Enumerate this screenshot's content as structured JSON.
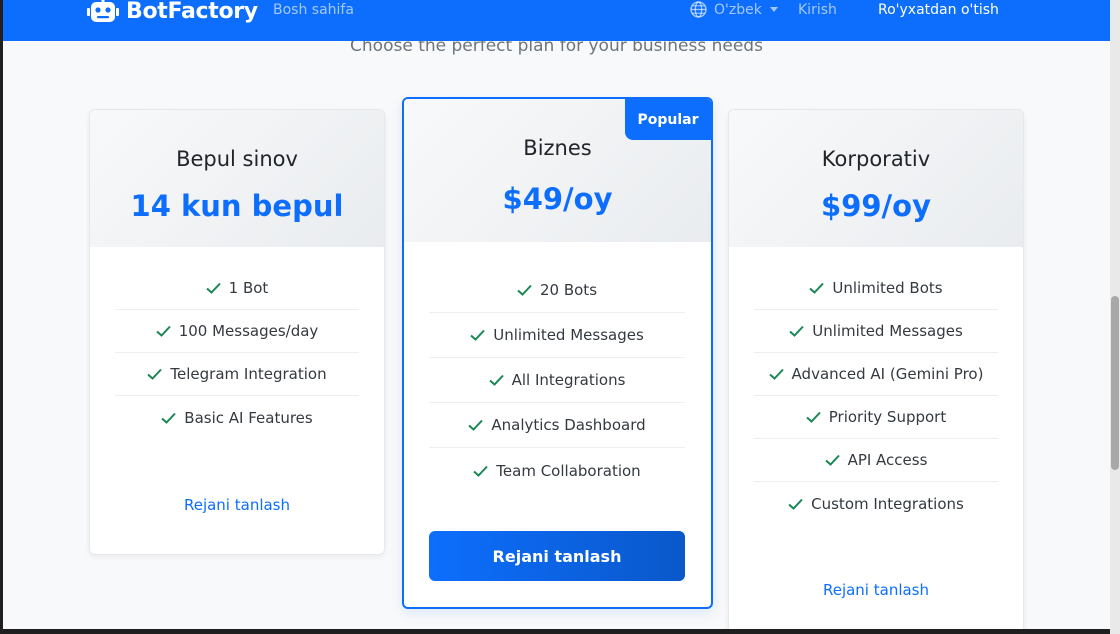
{
  "navbar": {
    "brand": "BotFactory",
    "home_link": "Bosh sahifa",
    "language": "O'zbek",
    "login": "Kirish",
    "register": "Ro'yxatdan o'tish"
  },
  "subtitle": "Choose the perfect plan for your business needs",
  "plans": [
    {
      "name": "Bepul sinov",
      "price": "14 kun bepul",
      "features": [
        "1 Bot",
        "100 Messages/day",
        "Telegram Integration",
        "Basic AI Features"
      ],
      "cta": "Rejani tanlash"
    },
    {
      "name": "Biznes",
      "price": "$49/oy",
      "badge": "Popular",
      "features": [
        "20 Bots",
        "Unlimited Messages",
        "All Integrations",
        "Analytics Dashboard",
        "Team Collaboration"
      ],
      "cta": "Rejani tanlash"
    },
    {
      "name": "Korporativ",
      "price": "$99/oy",
      "features": [
        "Unlimited Bots",
        "Unlimited Messages",
        "Advanced AI (Gemini Pro)",
        "Priority Support",
        "API Access",
        "Custom Integrations"
      ],
      "cta": "Rejani tanlash"
    }
  ],
  "colors": {
    "primary": "#0d6efd",
    "check": "#198754",
    "page_bg": "#f8f9fa"
  }
}
